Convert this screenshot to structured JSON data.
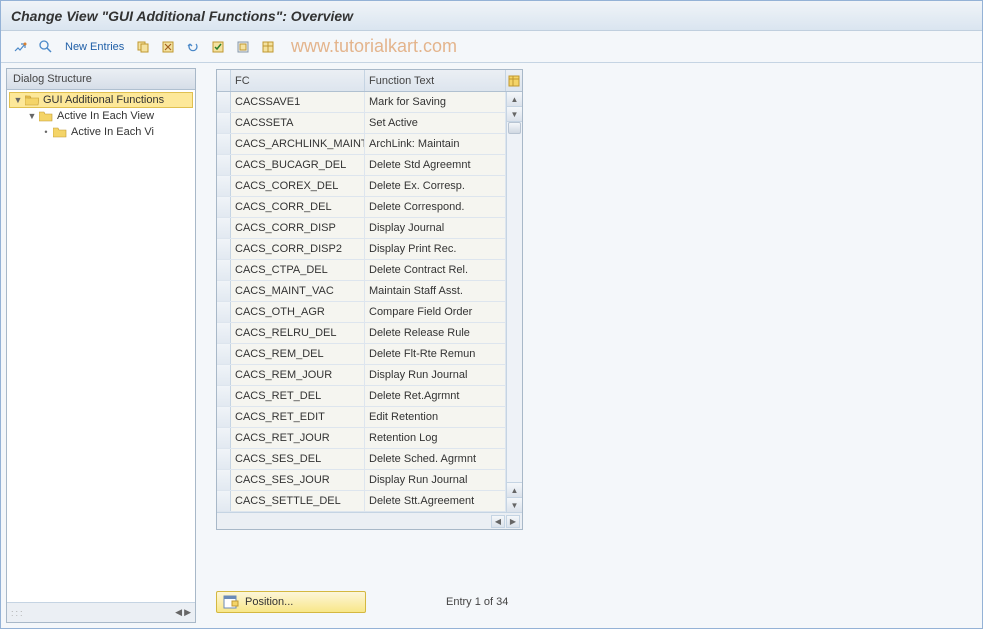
{
  "title": "Change View \"GUI Additional Functions\": Overview",
  "watermark": "www.tutorialkart.com",
  "toolbar": {
    "new_entries": "New Entries"
  },
  "panel": {
    "header": "Dialog Structure",
    "nodes": {
      "root": "GUI Additional Functions",
      "child1": "Active In Each View",
      "child2": "Active In Each Vi"
    }
  },
  "table": {
    "headers": {
      "fc": "FC",
      "ft": "Function Text"
    },
    "rows": [
      {
        "fc": "CACSSAVE1",
        "ft": "Mark for Saving"
      },
      {
        "fc": "CACSSETA",
        "ft": "Set Active"
      },
      {
        "fc": "CACS_ARCHLINK_MAINT",
        "ft": "ArchLink: Maintain"
      },
      {
        "fc": "CACS_BUCAGR_DEL",
        "ft": "Delete Std Agreemnt"
      },
      {
        "fc": "CACS_COREX_DEL",
        "ft": "Delete Ex. Corresp."
      },
      {
        "fc": "CACS_CORR_DEL",
        "ft": "Delete Correspond."
      },
      {
        "fc": "CACS_CORR_DISP",
        "ft": "Display Journal"
      },
      {
        "fc": "CACS_CORR_DISP2",
        "ft": "Display Print Rec."
      },
      {
        "fc": "CACS_CTPA_DEL",
        "ft": "Delete Contract Rel."
      },
      {
        "fc": "CACS_MAINT_VAC",
        "ft": "Maintain Staff Asst."
      },
      {
        "fc": "CACS_OTH_AGR",
        "ft": "Compare Field Order"
      },
      {
        "fc": "CACS_RELRU_DEL",
        "ft": "Delete Release Rule"
      },
      {
        "fc": "CACS_REM_DEL",
        "ft": "Delete Flt-Rte Remun"
      },
      {
        "fc": "CACS_REM_JOUR",
        "ft": "Display Run Journal"
      },
      {
        "fc": "CACS_RET_DEL",
        "ft": "Delete Ret.Agrmnt"
      },
      {
        "fc": "CACS_RET_EDIT",
        "ft": "Edit Retention"
      },
      {
        "fc": "CACS_RET_JOUR",
        "ft": "Retention Log"
      },
      {
        "fc": "CACS_SES_DEL",
        "ft": "Delete Sched. Agrmnt"
      },
      {
        "fc": "CACS_SES_JOUR",
        "ft": "Display Run Journal"
      },
      {
        "fc": "CACS_SETTLE_DEL",
        "ft": "Delete Stt.Agreement"
      }
    ]
  },
  "footer": {
    "position": "Position...",
    "entry": "Entry 1 of 34"
  }
}
